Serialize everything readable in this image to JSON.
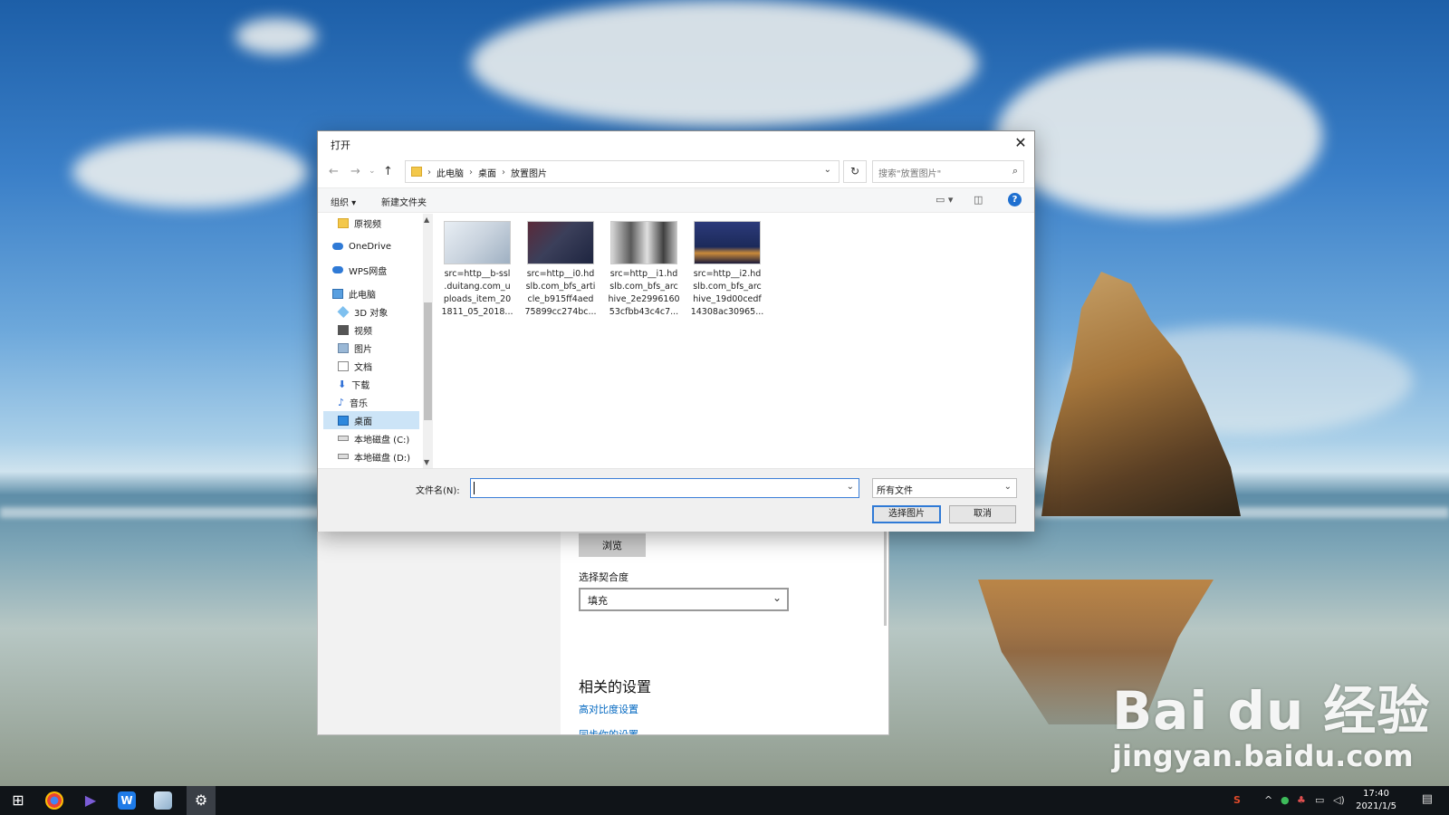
{
  "dialog": {
    "title": "打开",
    "breadcrumb": [
      "此电脑",
      "桌面",
      "放置图片"
    ],
    "search_placeholder": "搜索\"放置图片\"",
    "organize_label": "组织 ▾",
    "new_folder_label": "新建文件夹",
    "nav_items": [
      {
        "label": "原视频",
        "icon": "folder-icon"
      },
      {
        "label": "OneDrive",
        "icon": "cloud-icon"
      },
      {
        "label": "WPS网盘",
        "icon": "cloud-icon"
      },
      {
        "label": "此电脑",
        "icon": "pc-icon"
      },
      {
        "label": "3D 对象",
        "icon": "cube-icon"
      },
      {
        "label": "视频",
        "icon": "video-icon"
      },
      {
        "label": "图片",
        "icon": "picture-icon"
      },
      {
        "label": "文档",
        "icon": "document-icon"
      },
      {
        "label": "下载",
        "icon": "download-icon"
      },
      {
        "label": "音乐",
        "icon": "music-icon"
      },
      {
        "label": "桌面",
        "icon": "desktop-icon"
      },
      {
        "label": "本地磁盘 (C:)",
        "icon": "drive-icon"
      },
      {
        "label": "本地磁盘 (D:)",
        "icon": "drive-icon"
      }
    ],
    "selected_nav": "桌面",
    "files": [
      {
        "name_lines": [
          "src=http__b-ssl",
          ".duitang.com_u",
          "ploads_item_20",
          "1811_05_2018..."
        ],
        "thumb_color": "#c9d3de"
      },
      {
        "name_lines": [
          "src=http__i0.hd",
          "slb.com_bfs_arti",
          "cle_b915ff4aed",
          "75899cc274bc..."
        ],
        "thumb_color": "#3b3f5a"
      },
      {
        "name_lines": [
          "src=http__i1.hd",
          "slb.com_bfs_arc",
          "hive_2e2996160",
          "53cfbb43c4c7..."
        ],
        "thumb_color": "#8a8a8a"
      },
      {
        "name_lines": [
          "src=http__i2.hd",
          "slb.com_bfs_arc",
          "hive_19d00cedf",
          "14308ac30965..."
        ],
        "thumb_color": "#1c2a5a"
      }
    ],
    "filename_label": "文件名(N):",
    "filename_value": "",
    "filetype_value": "所有文件",
    "ok_label": "选择图片",
    "cancel_label": "取消"
  },
  "settings": {
    "browse_label": "浏览",
    "fit_label": "选择契合度",
    "fit_value": "填充",
    "related_title": "相关的设置",
    "link_high_contrast": "高对比度设置",
    "link_sync": "同步你的设置"
  },
  "watermark": {
    "brand": "Bai du 经验",
    "url": "jingyan.baidu.com"
  },
  "taskbar": {
    "time": "17:40",
    "date": "2021/1/5"
  }
}
